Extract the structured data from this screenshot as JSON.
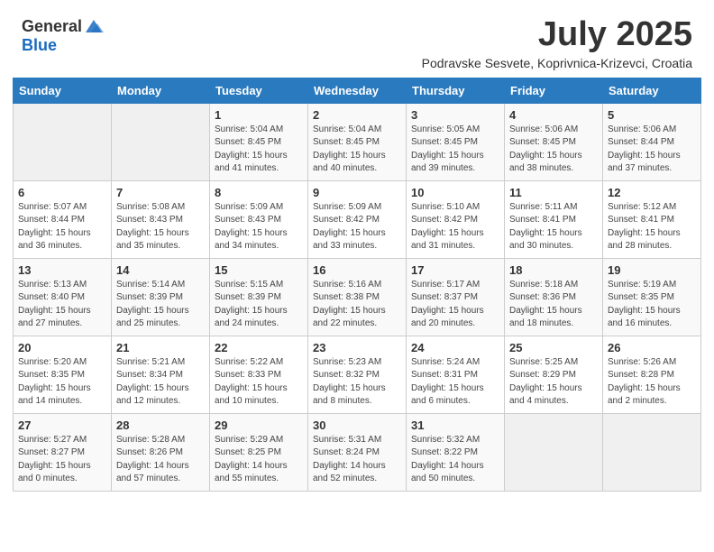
{
  "logo": {
    "general": "General",
    "blue": "Blue"
  },
  "title": "July 2025",
  "subtitle": "Podravske Sesvete, Koprivnica-Krizevci, Croatia",
  "days_of_week": [
    "Sunday",
    "Monday",
    "Tuesday",
    "Wednesday",
    "Thursday",
    "Friday",
    "Saturday"
  ],
  "weeks": [
    [
      {
        "day": "",
        "sunrise": "",
        "sunset": "",
        "daylight": "",
        "empty": true
      },
      {
        "day": "",
        "sunrise": "",
        "sunset": "",
        "daylight": "",
        "empty": true
      },
      {
        "day": "1",
        "sunrise": "Sunrise: 5:04 AM",
        "sunset": "Sunset: 8:45 PM",
        "daylight": "Daylight: 15 hours and 41 minutes."
      },
      {
        "day": "2",
        "sunrise": "Sunrise: 5:04 AM",
        "sunset": "Sunset: 8:45 PM",
        "daylight": "Daylight: 15 hours and 40 minutes."
      },
      {
        "day": "3",
        "sunrise": "Sunrise: 5:05 AM",
        "sunset": "Sunset: 8:45 PM",
        "daylight": "Daylight: 15 hours and 39 minutes."
      },
      {
        "day": "4",
        "sunrise": "Sunrise: 5:06 AM",
        "sunset": "Sunset: 8:45 PM",
        "daylight": "Daylight: 15 hours and 38 minutes."
      },
      {
        "day": "5",
        "sunrise": "Sunrise: 5:06 AM",
        "sunset": "Sunset: 8:44 PM",
        "daylight": "Daylight: 15 hours and 37 minutes."
      }
    ],
    [
      {
        "day": "6",
        "sunrise": "Sunrise: 5:07 AM",
        "sunset": "Sunset: 8:44 PM",
        "daylight": "Daylight: 15 hours and 36 minutes."
      },
      {
        "day": "7",
        "sunrise": "Sunrise: 5:08 AM",
        "sunset": "Sunset: 8:43 PM",
        "daylight": "Daylight: 15 hours and 35 minutes."
      },
      {
        "day": "8",
        "sunrise": "Sunrise: 5:09 AM",
        "sunset": "Sunset: 8:43 PM",
        "daylight": "Daylight: 15 hours and 34 minutes."
      },
      {
        "day": "9",
        "sunrise": "Sunrise: 5:09 AM",
        "sunset": "Sunset: 8:42 PM",
        "daylight": "Daylight: 15 hours and 33 minutes."
      },
      {
        "day": "10",
        "sunrise": "Sunrise: 5:10 AM",
        "sunset": "Sunset: 8:42 PM",
        "daylight": "Daylight: 15 hours and 31 minutes."
      },
      {
        "day": "11",
        "sunrise": "Sunrise: 5:11 AM",
        "sunset": "Sunset: 8:41 PM",
        "daylight": "Daylight: 15 hours and 30 minutes."
      },
      {
        "day": "12",
        "sunrise": "Sunrise: 5:12 AM",
        "sunset": "Sunset: 8:41 PM",
        "daylight": "Daylight: 15 hours and 28 minutes."
      }
    ],
    [
      {
        "day": "13",
        "sunrise": "Sunrise: 5:13 AM",
        "sunset": "Sunset: 8:40 PM",
        "daylight": "Daylight: 15 hours and 27 minutes."
      },
      {
        "day": "14",
        "sunrise": "Sunrise: 5:14 AM",
        "sunset": "Sunset: 8:39 PM",
        "daylight": "Daylight: 15 hours and 25 minutes."
      },
      {
        "day": "15",
        "sunrise": "Sunrise: 5:15 AM",
        "sunset": "Sunset: 8:39 PM",
        "daylight": "Daylight: 15 hours and 24 minutes."
      },
      {
        "day": "16",
        "sunrise": "Sunrise: 5:16 AM",
        "sunset": "Sunset: 8:38 PM",
        "daylight": "Daylight: 15 hours and 22 minutes."
      },
      {
        "day": "17",
        "sunrise": "Sunrise: 5:17 AM",
        "sunset": "Sunset: 8:37 PM",
        "daylight": "Daylight: 15 hours and 20 minutes."
      },
      {
        "day": "18",
        "sunrise": "Sunrise: 5:18 AM",
        "sunset": "Sunset: 8:36 PM",
        "daylight": "Daylight: 15 hours and 18 minutes."
      },
      {
        "day": "19",
        "sunrise": "Sunrise: 5:19 AM",
        "sunset": "Sunset: 8:35 PM",
        "daylight": "Daylight: 15 hours and 16 minutes."
      }
    ],
    [
      {
        "day": "20",
        "sunrise": "Sunrise: 5:20 AM",
        "sunset": "Sunset: 8:35 PM",
        "daylight": "Daylight: 15 hours and 14 minutes."
      },
      {
        "day": "21",
        "sunrise": "Sunrise: 5:21 AM",
        "sunset": "Sunset: 8:34 PM",
        "daylight": "Daylight: 15 hours and 12 minutes."
      },
      {
        "day": "22",
        "sunrise": "Sunrise: 5:22 AM",
        "sunset": "Sunset: 8:33 PM",
        "daylight": "Daylight: 15 hours and 10 minutes."
      },
      {
        "day": "23",
        "sunrise": "Sunrise: 5:23 AM",
        "sunset": "Sunset: 8:32 PM",
        "daylight": "Daylight: 15 hours and 8 minutes."
      },
      {
        "day": "24",
        "sunrise": "Sunrise: 5:24 AM",
        "sunset": "Sunset: 8:31 PM",
        "daylight": "Daylight: 15 hours and 6 minutes."
      },
      {
        "day": "25",
        "sunrise": "Sunrise: 5:25 AM",
        "sunset": "Sunset: 8:29 PM",
        "daylight": "Daylight: 15 hours and 4 minutes."
      },
      {
        "day": "26",
        "sunrise": "Sunrise: 5:26 AM",
        "sunset": "Sunset: 8:28 PM",
        "daylight": "Daylight: 15 hours and 2 minutes."
      }
    ],
    [
      {
        "day": "27",
        "sunrise": "Sunrise: 5:27 AM",
        "sunset": "Sunset: 8:27 PM",
        "daylight": "Daylight: 15 hours and 0 minutes."
      },
      {
        "day": "28",
        "sunrise": "Sunrise: 5:28 AM",
        "sunset": "Sunset: 8:26 PM",
        "daylight": "Daylight: 14 hours and 57 minutes."
      },
      {
        "day": "29",
        "sunrise": "Sunrise: 5:29 AM",
        "sunset": "Sunset: 8:25 PM",
        "daylight": "Daylight: 14 hours and 55 minutes."
      },
      {
        "day": "30",
        "sunrise": "Sunrise: 5:31 AM",
        "sunset": "Sunset: 8:24 PM",
        "daylight": "Daylight: 14 hours and 52 minutes."
      },
      {
        "day": "31",
        "sunrise": "Sunrise: 5:32 AM",
        "sunset": "Sunset: 8:22 PM",
        "daylight": "Daylight: 14 hours and 50 minutes."
      },
      {
        "day": "",
        "sunrise": "",
        "sunset": "",
        "daylight": "",
        "empty": true
      },
      {
        "day": "",
        "sunrise": "",
        "sunset": "",
        "daylight": "",
        "empty": true
      }
    ]
  ]
}
